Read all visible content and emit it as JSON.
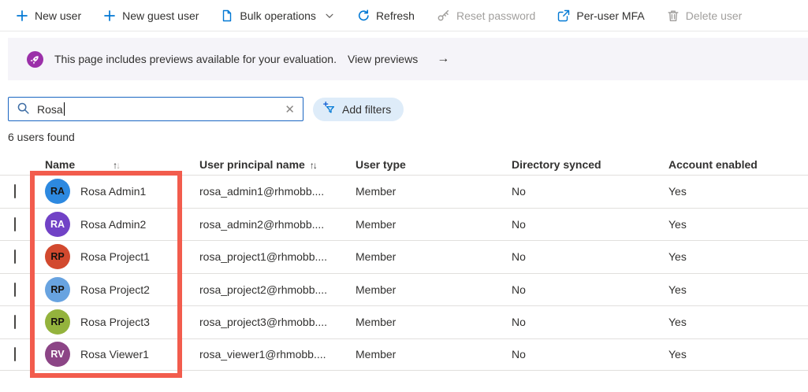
{
  "toolbar": {
    "items": [
      {
        "label": "New user",
        "icon": "plus-icon",
        "enabled": true
      },
      {
        "label": "New guest user",
        "icon": "plus-icon",
        "enabled": true
      },
      {
        "label": "Bulk operations",
        "icon": "document-icon",
        "enabled": true,
        "chevron": true
      },
      {
        "label": "Refresh",
        "icon": "refresh-icon",
        "enabled": true
      },
      {
        "label": "Reset password",
        "icon": "key-icon",
        "enabled": false
      },
      {
        "label": "Per-user MFA",
        "icon": "external-link-icon",
        "enabled": true
      },
      {
        "label": "Delete user",
        "icon": "trash-icon",
        "enabled": false
      }
    ]
  },
  "banner": {
    "text": "This page includes previews available for your evaluation.",
    "link_label": "View previews",
    "arrow": "→"
  },
  "search": {
    "value": "Rosa",
    "clear_label": "✕",
    "add_filters_label": "Add filters"
  },
  "results_count": "6 users found",
  "table": {
    "columns": [
      {
        "label": "Name",
        "sortable": true
      },
      {
        "label": "User principal name",
        "sortable": true
      },
      {
        "label": "User type",
        "sortable": false
      },
      {
        "label": "Directory synced",
        "sortable": false
      },
      {
        "label": "Account enabled",
        "sortable": false
      }
    ],
    "sort_up": "↑",
    "sort_down": "↓",
    "rows": [
      {
        "initials": "RA",
        "avatar_color": "#2d89e0",
        "initials_color": "#16130f",
        "name": "Rosa Admin1",
        "upn": "rosa_admin1@rhmobb....",
        "user_type": "Member",
        "directory_synced": "No",
        "account_enabled": "Yes"
      },
      {
        "initials": "RA",
        "avatar_color": "#7142c6",
        "initials_color": "#ffffff",
        "name": "Rosa Admin2",
        "upn": "rosa_admin2@rhmobb....",
        "user_type": "Member",
        "directory_synced": "No",
        "account_enabled": "Yes"
      },
      {
        "initials": "RP",
        "avatar_color": "#d2492e",
        "initials_color": "#16130f",
        "name": "Rosa Project1",
        "upn": "rosa_project1@rhmobb....",
        "user_type": "Member",
        "directory_synced": "No",
        "account_enabled": "Yes"
      },
      {
        "initials": "RP",
        "avatar_color": "#68a3e0",
        "initials_color": "#16130f",
        "name": "Rosa Project2",
        "upn": "rosa_project2@rhmobb....",
        "user_type": "Member",
        "directory_synced": "No",
        "account_enabled": "Yes"
      },
      {
        "initials": "RP",
        "avatar_color": "#94b33d",
        "initials_color": "#16130f",
        "name": "Rosa Project3",
        "upn": "rosa_project3@rhmobb....",
        "user_type": "Member",
        "directory_synced": "No",
        "account_enabled": "Yes"
      },
      {
        "initials": "RV",
        "avatar_color": "#8c4586",
        "initials_color": "#ffffff",
        "name": "Rosa Viewer1",
        "upn": "rosa_viewer1@rhmobb....",
        "user_type": "Member",
        "directory_synced": "No",
        "account_enabled": "Yes"
      }
    ]
  },
  "colors": {
    "accent": "#0078d4",
    "annotation": "#f25c4d",
    "banner_icon": "#9b30a9",
    "pill_bg": "#deecf9"
  }
}
